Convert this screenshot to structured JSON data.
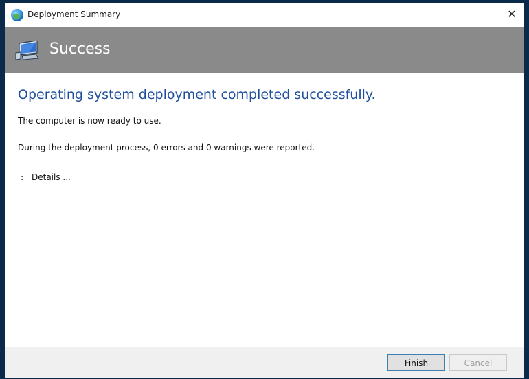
{
  "window": {
    "title": "Deployment Summary",
    "close_glyph": "✕"
  },
  "banner": {
    "title": "Success",
    "icon": "computer-icon"
  },
  "content": {
    "heading": "Operating system deployment completed successfully.",
    "line1": "The computer is now ready to use.",
    "line2": "During the deployment process, 0 errors and 0 warnings were reported.",
    "details_label": "Details ..."
  },
  "footer": {
    "finish_label": "Finish",
    "cancel_label": "Cancel"
  },
  "colors": {
    "banner_bg": "#8a8a8a",
    "heading": "#1f4f9c",
    "background": "#0a2a4a"
  }
}
